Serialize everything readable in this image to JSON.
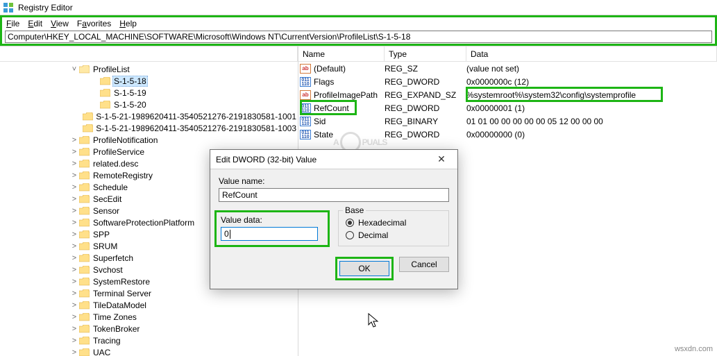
{
  "app": {
    "title": "Registry Editor"
  },
  "menu": {
    "file": "File",
    "edit": "Edit",
    "view": "View",
    "favorites": "Favorites",
    "help": "Help"
  },
  "address": "Computer\\HKEY_LOCAL_MACHINE\\SOFTWARE\\Microsoft\\Windows NT\\CurrentVersion\\ProfileList\\S-1-5-18",
  "tree": {
    "root": "ProfileList",
    "selected": "S-1-5-18",
    "sids": [
      "S-1-5-18",
      "S-1-5-19",
      "S-1-5-20",
      "S-1-5-21-1989620411-3540521276-2191830581-1001",
      "S-1-5-21-1989620411-3540521276-2191830581-1003"
    ],
    "siblings": [
      "ProfileNotification",
      "ProfileService",
      "related.desc",
      "RemoteRegistry",
      "Schedule",
      "SecEdit",
      "Sensor",
      "SoftwareProtectionPlatform",
      "SPP",
      "SRUM",
      "Superfetch",
      "Svchost",
      "SystemRestore",
      "Terminal Server",
      "TileDataModel",
      "Time Zones",
      "TokenBroker",
      "Tracing",
      "UAC"
    ]
  },
  "list": {
    "headers": {
      "name": "Name",
      "type": "Type",
      "data": "Data"
    },
    "rows": [
      {
        "icon": "ab",
        "name": "(Default)",
        "type": "REG_SZ",
        "data": "(value not set)"
      },
      {
        "icon": "bin",
        "name": "Flags",
        "type": "REG_DWORD",
        "data": "0x0000000c (12)"
      },
      {
        "icon": "ab",
        "name": "ProfileImagePath",
        "type": "REG_EXPAND_SZ",
        "data": "%systemroot%\\system32\\config\\systemprofile"
      },
      {
        "icon": "bin",
        "name": "RefCount",
        "type": "REG_DWORD",
        "data": "0x00000001 (1)"
      },
      {
        "icon": "bin",
        "name": "Sid",
        "type": "REG_BINARY",
        "data": "01 01 00 00 00 00 00 05 12 00 00 00"
      },
      {
        "icon": "bin",
        "name": "State",
        "type": "REG_DWORD",
        "data": "0x00000000 (0)"
      }
    ]
  },
  "dialog": {
    "title": "Edit DWORD (32-bit) Value",
    "valuename_label": "Value name:",
    "valuename": "RefCount",
    "valuedata_label": "Value data:",
    "valuedata": "0",
    "base_label": "Base",
    "hex": "Hexadecimal",
    "dec": "Decimal",
    "ok": "OK",
    "cancel": "Cancel"
  },
  "watermark": {
    "a": "A",
    "b": "PUALS"
  },
  "credit": "wsxdn.com"
}
